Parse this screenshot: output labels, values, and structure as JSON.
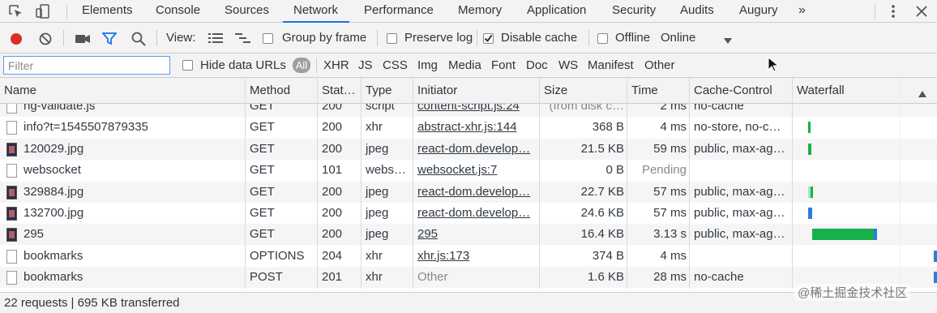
{
  "tabs": [
    {
      "label": "Elements",
      "active": false
    },
    {
      "label": "Console",
      "active": false
    },
    {
      "label": "Sources",
      "active": false
    },
    {
      "label": "Network",
      "active": true
    },
    {
      "label": "Performance",
      "active": false
    },
    {
      "label": "Memory",
      "active": false
    },
    {
      "label": "Application",
      "active": false
    },
    {
      "label": "Security",
      "active": false
    },
    {
      "label": "Audits",
      "active": false
    },
    {
      "label": "Augury",
      "active": false
    }
  ],
  "more_tabs_glyph": "»",
  "toolbar": {
    "view_label": "View:",
    "group_by_frame": {
      "label": "Group by frame",
      "checked": false
    },
    "preserve_log": {
      "label": "Preserve log",
      "checked": false
    },
    "disable_cache": {
      "label": "Disable cache",
      "checked": true
    },
    "offline": {
      "label": "Offline",
      "checked": false
    },
    "throttling": "Online"
  },
  "filter": {
    "placeholder": "Filter",
    "hide_data_urls": {
      "label": "Hide data URLs",
      "checked": false
    },
    "all_label": "All",
    "types": [
      "XHR",
      "JS",
      "CSS",
      "Img",
      "Media",
      "Font",
      "Doc",
      "WS",
      "Manifest",
      "Other"
    ]
  },
  "columns": [
    "Name",
    "Method",
    "Stat…",
    "Type",
    "Initiator",
    "Size",
    "Time",
    "Cache-Control",
    "Waterfall"
  ],
  "rows": [
    {
      "name": "ng-validate.js",
      "icon": "doc",
      "method": "GET",
      "status": "200",
      "type": "script",
      "initiator": "content-script.js:24",
      "initiator_link": true,
      "size": "(from disk c…",
      "size_grey": true,
      "time": "2 ms",
      "time_grey": false,
      "cache": "no-cache"
    },
    {
      "name": "info?t=1545507879335",
      "icon": "doc",
      "method": "GET",
      "status": "200",
      "type": "xhr",
      "initiator": "abstract-xhr.js:144",
      "initiator_link": true,
      "size": "368 B",
      "size_grey": false,
      "time": "4 ms",
      "time_grey": false,
      "cache": "no-store, no-c…"
    },
    {
      "name": "120029.jpg",
      "icon": "img",
      "method": "GET",
      "status": "200",
      "type": "jpeg",
      "initiator": "react-dom.develop…",
      "initiator_link": true,
      "size": "21.5 KB",
      "size_grey": false,
      "time": "59 ms",
      "time_grey": false,
      "cache": "public, max-ag…"
    },
    {
      "name": "websocket",
      "icon": "doc",
      "method": "GET",
      "status": "101",
      "type": "webs…",
      "initiator": "websocket.js:7",
      "initiator_link": true,
      "size": "0 B",
      "size_grey": false,
      "time": "Pending",
      "time_grey": true,
      "cache": ""
    },
    {
      "name": "329884.jpg",
      "icon": "img",
      "method": "GET",
      "status": "200",
      "type": "jpeg",
      "initiator": "react-dom.develop…",
      "initiator_link": true,
      "size": "22.7 KB",
      "size_grey": false,
      "time": "57 ms",
      "time_grey": false,
      "cache": "public, max-ag…"
    },
    {
      "name": "132700.jpg",
      "icon": "img",
      "method": "GET",
      "status": "200",
      "type": "jpeg",
      "initiator": "react-dom.develop…",
      "initiator_link": true,
      "size": "24.6 KB",
      "size_grey": false,
      "time": "57 ms",
      "time_grey": false,
      "cache": "public, max-ag…"
    },
    {
      "name": "295",
      "icon": "img",
      "method": "GET",
      "status": "200",
      "type": "jpeg",
      "initiator": "295",
      "initiator_link": true,
      "size": "16.4 KB",
      "size_grey": false,
      "time": "3.13 s",
      "time_grey": false,
      "cache": "public, max-ag…"
    },
    {
      "name": "bookmarks",
      "icon": "doc",
      "method": "OPTIONS",
      "status": "204",
      "type": "xhr",
      "initiator": "xhr.js:173",
      "initiator_link": true,
      "size": "374 B",
      "size_grey": false,
      "time": "4 ms",
      "time_grey": false,
      "cache": ""
    },
    {
      "name": "bookmarks",
      "icon": "doc",
      "method": "POST",
      "status": "201",
      "type": "xhr",
      "initiator": "Other",
      "initiator_link": false,
      "size": "1.6 KB",
      "size_grey": false,
      "time": "28 ms",
      "time_grey": false,
      "cache": "no-cache"
    }
  ],
  "status": "22 requests | 695 KB transferred",
  "watermark": "@稀土掘金技术社区",
  "colors": {
    "accent": "#1a73e8",
    "record": "#d93025",
    "bar_wait": "#18b04a",
    "bar_download": "#2a7fd5"
  }
}
